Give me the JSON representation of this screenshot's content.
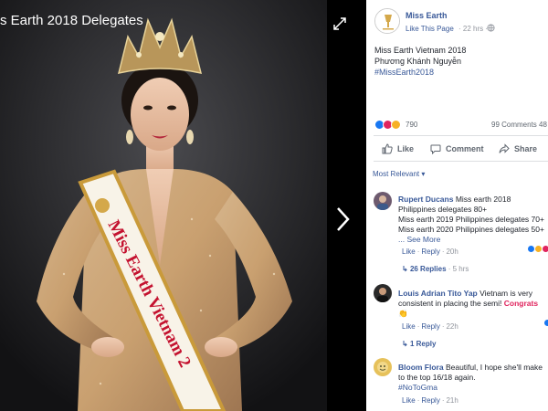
{
  "viewer": {
    "title": "s Earth 2018 Delegates",
    "sash_text": "Miss Earth Vietnam 2"
  },
  "post": {
    "page_name": "Miss Earth",
    "like_page_label": "Like This Page",
    "time": "· 22 hrs ·",
    "lines": [
      "Miss Earth Vietnam 2018",
      "Phương Khánh Nguyễn"
    ],
    "hashtag": "#MissEarth2018",
    "reaction_count": "790",
    "comment_count": "99 Comments  48"
  },
  "actions": {
    "like": "Like",
    "comment": "Comment",
    "share": "Share"
  },
  "sort": {
    "selected": "Most Relevant ▾"
  },
  "comments": [
    {
      "author": "Rupert Ducans",
      "lines": [
        " Miss earth 2018",
        "Philippines delegates 80+",
        "Miss earth 2019 Philippines delegates 70+",
        "Miss earth 2020 Philippines delegates 50+"
      ],
      "see_more": "... See More",
      "like": "Like",
      "reply": "Reply",
      "time": "20h",
      "replies": "26 Replies",
      "replies_time": "· 5 hrs"
    },
    {
      "author": "Louis Adrian Tito Yap",
      "lines": [
        " Vietnam is very",
        "consistent in placing the semi! "
      ],
      "highlight": "Congrats",
      "like": "Like",
      "reply": "Reply",
      "time": "22h",
      "replies": "1 Reply"
    },
    {
      "author": "Bloom Flora",
      "lines": [
        " Beautiful, I hope she'll make",
        "to the top 16/18 again."
      ],
      "hashtag": "#NoToGma",
      "like": "Like",
      "reply": "Reply",
      "time": "21h"
    }
  ],
  "colors": {
    "link": "#385898",
    "muted": "#90949c",
    "like_blue": "#1877f2",
    "love_red": "#e0245e",
    "haha_yellow": "#f7b125"
  }
}
